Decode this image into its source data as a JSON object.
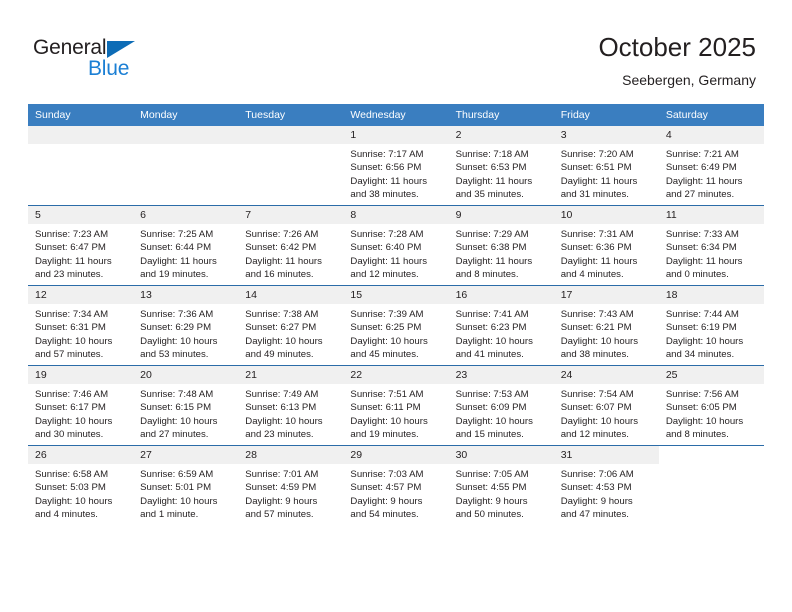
{
  "brand": {
    "name_top": "General",
    "name_bottom": "Blue",
    "triangle_color": "#0d6cb6",
    "blue_color": "#1b7fd4"
  },
  "header": {
    "title": "October 2025",
    "location": "Seebergen, Germany",
    "header_bg": "#3a7ec0",
    "band_bg": "#f0f0f0",
    "rule_color": "#2b6ca8"
  },
  "weekday_headers": [
    "Sunday",
    "Monday",
    "Tuesday",
    "Wednesday",
    "Thursday",
    "Friday",
    "Saturday"
  ],
  "weeks": [
    [
      {
        "day": "",
        "sunrise": "",
        "sunset": "",
        "daylight1": "",
        "daylight2": "",
        "state": "empty"
      },
      {
        "day": "",
        "sunrise": "",
        "sunset": "",
        "daylight1": "",
        "daylight2": "",
        "state": "empty"
      },
      {
        "day": "",
        "sunrise": "",
        "sunset": "",
        "daylight1": "",
        "daylight2": "",
        "state": "empty"
      },
      {
        "day": "1",
        "sunrise": "Sunrise: 7:17 AM",
        "sunset": "Sunset: 6:56 PM",
        "daylight1": "Daylight: 11 hours",
        "daylight2": "and 38 minutes.",
        "state": "filled"
      },
      {
        "day": "2",
        "sunrise": "Sunrise: 7:18 AM",
        "sunset": "Sunset: 6:53 PM",
        "daylight1": "Daylight: 11 hours",
        "daylight2": "and 35 minutes.",
        "state": "filled"
      },
      {
        "day": "3",
        "sunrise": "Sunrise: 7:20 AM",
        "sunset": "Sunset: 6:51 PM",
        "daylight1": "Daylight: 11 hours",
        "daylight2": "and 31 minutes.",
        "state": "filled"
      },
      {
        "day": "4",
        "sunrise": "Sunrise: 7:21 AM",
        "sunset": "Sunset: 6:49 PM",
        "daylight1": "Daylight: 11 hours",
        "daylight2": "and 27 minutes.",
        "state": "filled"
      }
    ],
    [
      {
        "day": "5",
        "sunrise": "Sunrise: 7:23 AM",
        "sunset": "Sunset: 6:47 PM",
        "daylight1": "Daylight: 11 hours",
        "daylight2": "and 23 minutes.",
        "state": "filled"
      },
      {
        "day": "6",
        "sunrise": "Sunrise: 7:25 AM",
        "sunset": "Sunset: 6:44 PM",
        "daylight1": "Daylight: 11 hours",
        "daylight2": "and 19 minutes.",
        "state": "filled"
      },
      {
        "day": "7",
        "sunrise": "Sunrise: 7:26 AM",
        "sunset": "Sunset: 6:42 PM",
        "daylight1": "Daylight: 11 hours",
        "daylight2": "and 16 minutes.",
        "state": "filled"
      },
      {
        "day": "8",
        "sunrise": "Sunrise: 7:28 AM",
        "sunset": "Sunset: 6:40 PM",
        "daylight1": "Daylight: 11 hours",
        "daylight2": "and 12 minutes.",
        "state": "filled"
      },
      {
        "day": "9",
        "sunrise": "Sunrise: 7:29 AM",
        "sunset": "Sunset: 6:38 PM",
        "daylight1": "Daylight: 11 hours",
        "daylight2": "and 8 minutes.",
        "state": "filled"
      },
      {
        "day": "10",
        "sunrise": "Sunrise: 7:31 AM",
        "sunset": "Sunset: 6:36 PM",
        "daylight1": "Daylight: 11 hours",
        "daylight2": "and 4 minutes.",
        "state": "filled"
      },
      {
        "day": "11",
        "sunrise": "Sunrise: 7:33 AM",
        "sunset": "Sunset: 6:34 PM",
        "daylight1": "Daylight: 11 hours",
        "daylight2": "and 0 minutes.",
        "state": "filled"
      }
    ],
    [
      {
        "day": "12",
        "sunrise": "Sunrise: 7:34 AM",
        "sunset": "Sunset: 6:31 PM",
        "daylight1": "Daylight: 10 hours",
        "daylight2": "and 57 minutes.",
        "state": "filled"
      },
      {
        "day": "13",
        "sunrise": "Sunrise: 7:36 AM",
        "sunset": "Sunset: 6:29 PM",
        "daylight1": "Daylight: 10 hours",
        "daylight2": "and 53 minutes.",
        "state": "filled"
      },
      {
        "day": "14",
        "sunrise": "Sunrise: 7:38 AM",
        "sunset": "Sunset: 6:27 PM",
        "daylight1": "Daylight: 10 hours",
        "daylight2": "and 49 minutes.",
        "state": "filled"
      },
      {
        "day": "15",
        "sunrise": "Sunrise: 7:39 AM",
        "sunset": "Sunset: 6:25 PM",
        "daylight1": "Daylight: 10 hours",
        "daylight2": "and 45 minutes.",
        "state": "filled"
      },
      {
        "day": "16",
        "sunrise": "Sunrise: 7:41 AM",
        "sunset": "Sunset: 6:23 PM",
        "daylight1": "Daylight: 10 hours",
        "daylight2": "and 41 minutes.",
        "state": "filled"
      },
      {
        "day": "17",
        "sunrise": "Sunrise: 7:43 AM",
        "sunset": "Sunset: 6:21 PM",
        "daylight1": "Daylight: 10 hours",
        "daylight2": "and 38 minutes.",
        "state": "filled"
      },
      {
        "day": "18",
        "sunrise": "Sunrise: 7:44 AM",
        "sunset": "Sunset: 6:19 PM",
        "daylight1": "Daylight: 10 hours",
        "daylight2": "and 34 minutes.",
        "state": "filled"
      }
    ],
    [
      {
        "day": "19",
        "sunrise": "Sunrise: 7:46 AM",
        "sunset": "Sunset: 6:17 PM",
        "daylight1": "Daylight: 10 hours",
        "daylight2": "and 30 minutes.",
        "state": "filled"
      },
      {
        "day": "20",
        "sunrise": "Sunrise: 7:48 AM",
        "sunset": "Sunset: 6:15 PM",
        "daylight1": "Daylight: 10 hours",
        "daylight2": "and 27 minutes.",
        "state": "filled"
      },
      {
        "day": "21",
        "sunrise": "Sunrise: 7:49 AM",
        "sunset": "Sunset: 6:13 PM",
        "daylight1": "Daylight: 10 hours",
        "daylight2": "and 23 minutes.",
        "state": "filled"
      },
      {
        "day": "22",
        "sunrise": "Sunrise: 7:51 AM",
        "sunset": "Sunset: 6:11 PM",
        "daylight1": "Daylight: 10 hours",
        "daylight2": "and 19 minutes.",
        "state": "filled"
      },
      {
        "day": "23",
        "sunrise": "Sunrise: 7:53 AM",
        "sunset": "Sunset: 6:09 PM",
        "daylight1": "Daylight: 10 hours",
        "daylight2": "and 15 minutes.",
        "state": "filled"
      },
      {
        "day": "24",
        "sunrise": "Sunrise: 7:54 AM",
        "sunset": "Sunset: 6:07 PM",
        "daylight1": "Daylight: 10 hours",
        "daylight2": "and 12 minutes.",
        "state": "filled"
      },
      {
        "day": "25",
        "sunrise": "Sunrise: 7:56 AM",
        "sunset": "Sunset: 6:05 PM",
        "daylight1": "Daylight: 10 hours",
        "daylight2": "and 8 minutes.",
        "state": "filled"
      }
    ],
    [
      {
        "day": "26",
        "sunrise": "Sunrise: 6:58 AM",
        "sunset": "Sunset: 5:03 PM",
        "daylight1": "Daylight: 10 hours",
        "daylight2": "and 4 minutes.",
        "state": "filled"
      },
      {
        "day": "27",
        "sunrise": "Sunrise: 6:59 AM",
        "sunset": "Sunset: 5:01 PM",
        "daylight1": "Daylight: 10 hours",
        "daylight2": "and 1 minute.",
        "state": "filled"
      },
      {
        "day": "28",
        "sunrise": "Sunrise: 7:01 AM",
        "sunset": "Sunset: 4:59 PM",
        "daylight1": "Daylight: 9 hours",
        "daylight2": "and 57 minutes.",
        "state": "filled"
      },
      {
        "day": "29",
        "sunrise": "Sunrise: 7:03 AM",
        "sunset": "Sunset: 4:57 PM",
        "daylight1": "Daylight: 9 hours",
        "daylight2": "and 54 minutes.",
        "state": "filled"
      },
      {
        "day": "30",
        "sunrise": "Sunrise: 7:05 AM",
        "sunset": "Sunset: 4:55 PM",
        "daylight1": "Daylight: 9 hours",
        "daylight2": "and 50 minutes.",
        "state": "filled"
      },
      {
        "day": "31",
        "sunrise": "Sunrise: 7:06 AM",
        "sunset": "Sunset: 4:53 PM",
        "daylight1": "Daylight: 9 hours",
        "daylight2": "and 47 minutes.",
        "state": "filled"
      },
      {
        "day": "",
        "sunrise": "",
        "sunset": "",
        "daylight1": "",
        "daylight2": "",
        "state": "blank"
      }
    ]
  ]
}
